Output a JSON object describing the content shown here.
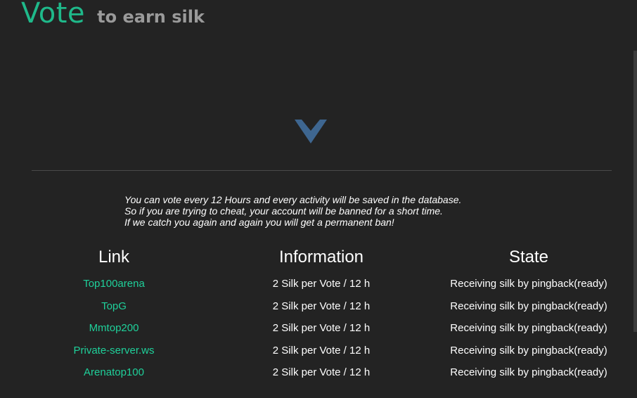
{
  "header": {
    "title": "Vote",
    "subtitle": "to earn silk"
  },
  "notice": {
    "lines": [
      "You can vote every 12 Hours and every activity will be saved in the database.",
      "So if you are trying to cheat, your account will be banned for a short time.",
      "If we catch you again and again you will get a permanent ban!"
    ]
  },
  "table": {
    "headers": [
      "Link",
      "Information",
      "State"
    ],
    "rows": [
      {
        "link": "Top100arena",
        "info": "2 Silk per Vote / 12 h",
        "state": "Receiving silk by pingback(ready)"
      },
      {
        "link": "TopG",
        "info": "2 Silk per Vote / 12 h",
        "state": "Receiving silk by pingback(ready)"
      },
      {
        "link": "Mmtop200",
        "info": "2 Silk per Vote / 12 h",
        "state": "Receiving silk by pingback(ready)"
      },
      {
        "link": "Private-server.ws",
        "info": "2 Silk per Vote / 12 h",
        "state": "Receiving silk by pingback(ready)"
      },
      {
        "link": "Arenatop100",
        "info": "2 Silk per Vote / 12 h",
        "state": "Receiving silk by pingback(ready)"
      }
    ]
  },
  "colors": {
    "accent": "#1fb98a",
    "link": "#1fd09a",
    "chevron": "#3e6690",
    "background": "#232323"
  },
  "icons": {
    "scroll_down": "chevron-down-icon"
  }
}
